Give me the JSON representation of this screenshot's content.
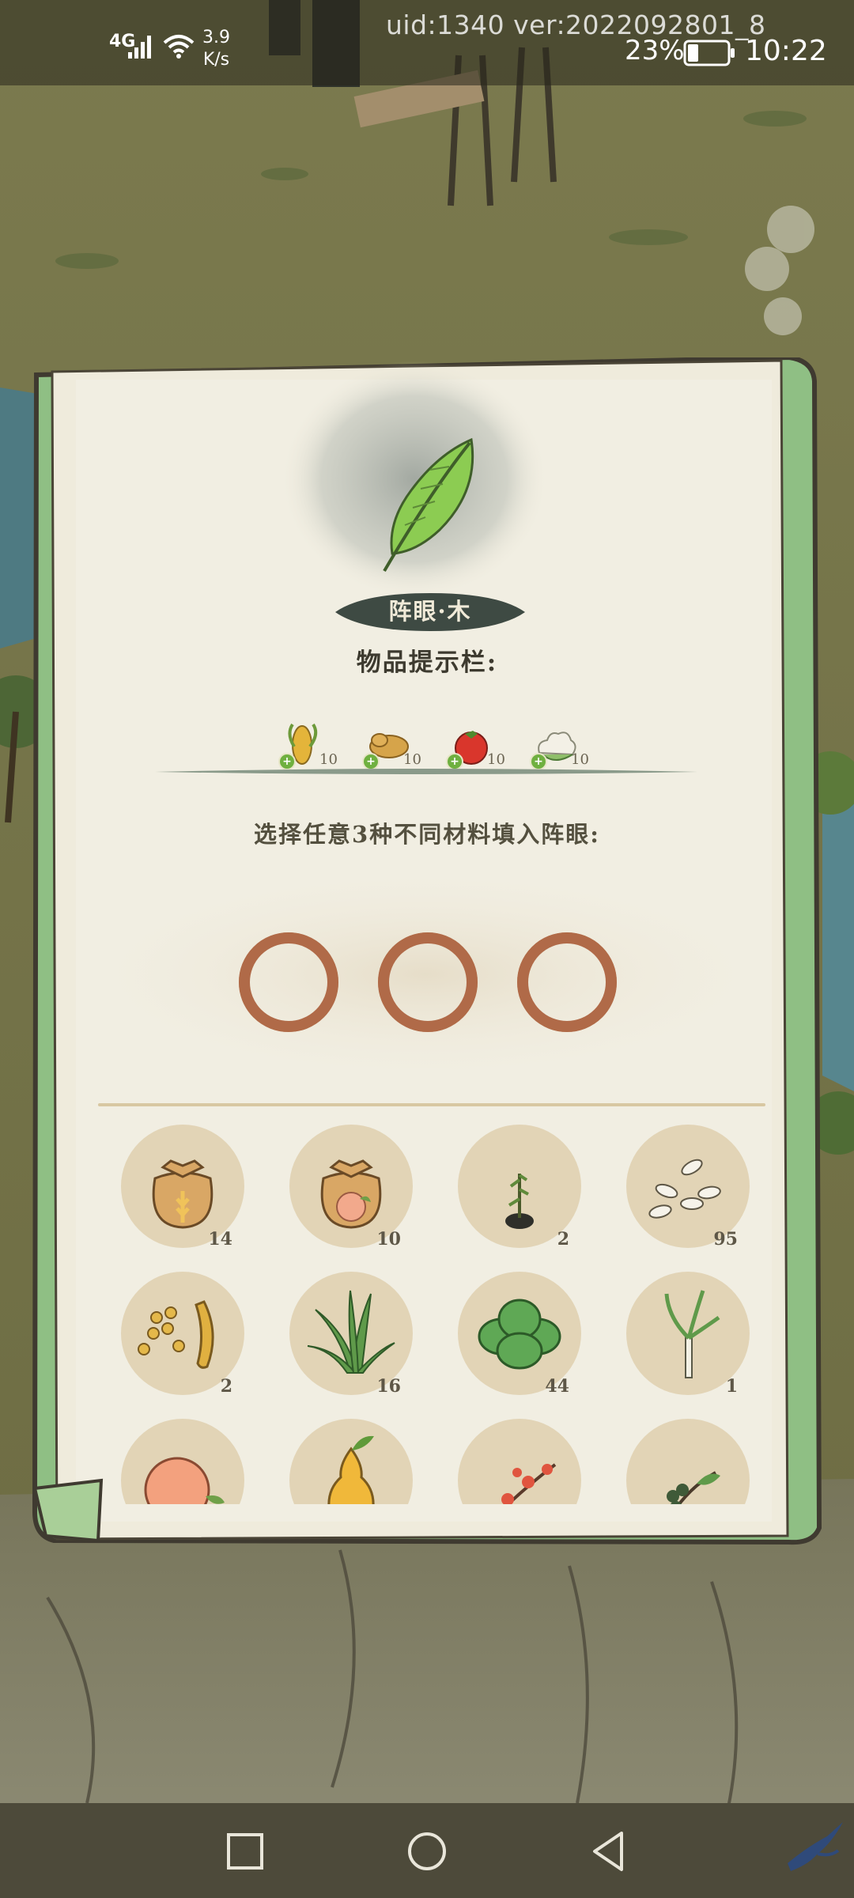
{
  "status_bar": {
    "network": "4G",
    "speed_value": "3.9",
    "speed_unit": "K/s",
    "build_info": "uid:1340 ver:2022092801_8",
    "battery": "23%",
    "time": "10:22"
  },
  "panel": {
    "element_name": "阵眼·木",
    "hint_title": "物品提示栏:",
    "hint_items": [
      {
        "icon": "corn-icon",
        "count": "10"
      },
      {
        "icon": "potato-icon",
        "count": "10"
      },
      {
        "icon": "tomato-icon",
        "count": "10"
      },
      {
        "icon": "cauliflower-icon",
        "count": "10"
      }
    ],
    "instruction": "选择任意3种不同材料填入阵眼:",
    "slots": [
      "empty",
      "empty",
      "empty"
    ],
    "materials": [
      {
        "icon": "wheat-seed-bag-icon",
        "count": "14"
      },
      {
        "icon": "peach-seed-bag-icon",
        "count": "10"
      },
      {
        "icon": "sapling-icon",
        "count": "2"
      },
      {
        "icon": "rice-grains-icon",
        "count": "95"
      },
      {
        "icon": "soybean-pod-icon",
        "count": "2"
      },
      {
        "icon": "grass-icon",
        "count": "16"
      },
      {
        "icon": "bok-choy-icon",
        "count": "44"
      },
      {
        "icon": "scallion-icon",
        "count": "1"
      },
      {
        "icon": "peach-icon",
        "count": ""
      },
      {
        "icon": "pear-icon",
        "count": ""
      },
      {
        "icon": "plum-blossom-icon",
        "count": ""
      },
      {
        "icon": "berry-branch-icon",
        "count": ""
      }
    ]
  },
  "colors": {
    "paper": "#efebdc",
    "scroll_edge": "#8fbf84",
    "slot_ring": "#b06a48",
    "leaf": "#8ccc52",
    "tag": "#3e4a43"
  }
}
